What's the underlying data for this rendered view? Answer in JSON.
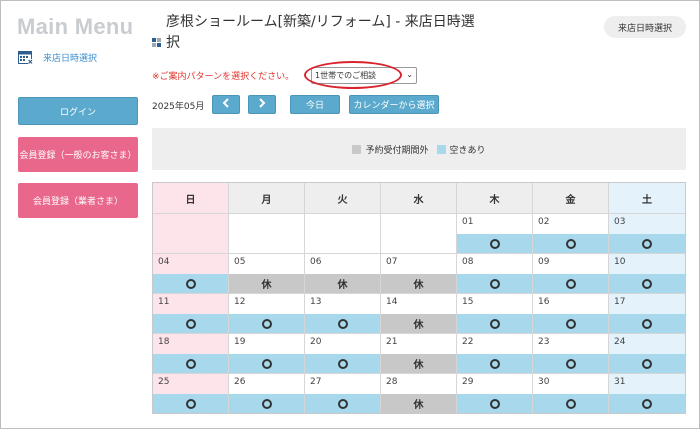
{
  "sidebar": {
    "menu_title": "Main Menu",
    "link_label": "来店日時選択",
    "buttons": {
      "login": "ログイン",
      "register_general": "会員登録（一般のお客さま）",
      "register_business": "会員登録（業者さま）"
    }
  },
  "header": {
    "title": "彦根ショールーム[新築/リフォーム] - 来店日時選択",
    "pill": "来店日時選択"
  },
  "selector": {
    "prompt": "※ご案内パターンを選択ください。",
    "selected": "1世帯でのご相談"
  },
  "toolbar": {
    "month": "2025年05月",
    "prev_icon": "chevron-left-icon",
    "next_icon": "chevron-right-icon",
    "today": "今日",
    "from_calendar": "カレンダーから選択"
  },
  "legend": {
    "outside": "予約受付期間外",
    "available": "空きあり"
  },
  "calendar": {
    "weekdays": [
      "日",
      "月",
      "火",
      "水",
      "木",
      "金",
      "土"
    ],
    "available_mark": "○",
    "closed_label": "休",
    "days": [
      {
        "day": "01",
        "status": "open"
      },
      {
        "day": "02",
        "status": "open"
      },
      {
        "day": "03",
        "status": "open"
      },
      {
        "day": "04",
        "status": "open"
      },
      {
        "day": "05",
        "status": "closed"
      },
      {
        "day": "06",
        "status": "closed"
      },
      {
        "day": "07",
        "status": "closed"
      },
      {
        "day": "08",
        "status": "open"
      },
      {
        "day": "09",
        "status": "open"
      },
      {
        "day": "10",
        "status": "open"
      },
      {
        "day": "11",
        "status": "open"
      },
      {
        "day": "12",
        "status": "open"
      },
      {
        "day": "13",
        "status": "open"
      },
      {
        "day": "14",
        "status": "closed"
      },
      {
        "day": "15",
        "status": "open"
      },
      {
        "day": "16",
        "status": "open"
      },
      {
        "day": "17",
        "status": "open"
      },
      {
        "day": "18",
        "status": "open"
      },
      {
        "day": "19",
        "status": "open"
      },
      {
        "day": "20",
        "status": "open"
      },
      {
        "day": "21",
        "status": "closed"
      },
      {
        "day": "22",
        "status": "open"
      },
      {
        "day": "23",
        "status": "open"
      },
      {
        "day": "24",
        "status": "open"
      },
      {
        "day": "25",
        "status": "open"
      },
      {
        "day": "26",
        "status": "open"
      },
      {
        "day": "27",
        "status": "open"
      },
      {
        "day": "28",
        "status": "closed"
      },
      {
        "day": "29",
        "status": "open"
      },
      {
        "day": "30",
        "status": "open"
      },
      {
        "day": "31",
        "status": "open"
      }
    ]
  },
  "colors": {
    "accent_blue": "#5ba9cd",
    "register_pink": "#e8678a",
    "available": "#a8d8ec",
    "outside": "#c8c8c8",
    "highlight_ellipse": "#d9232d"
  }
}
